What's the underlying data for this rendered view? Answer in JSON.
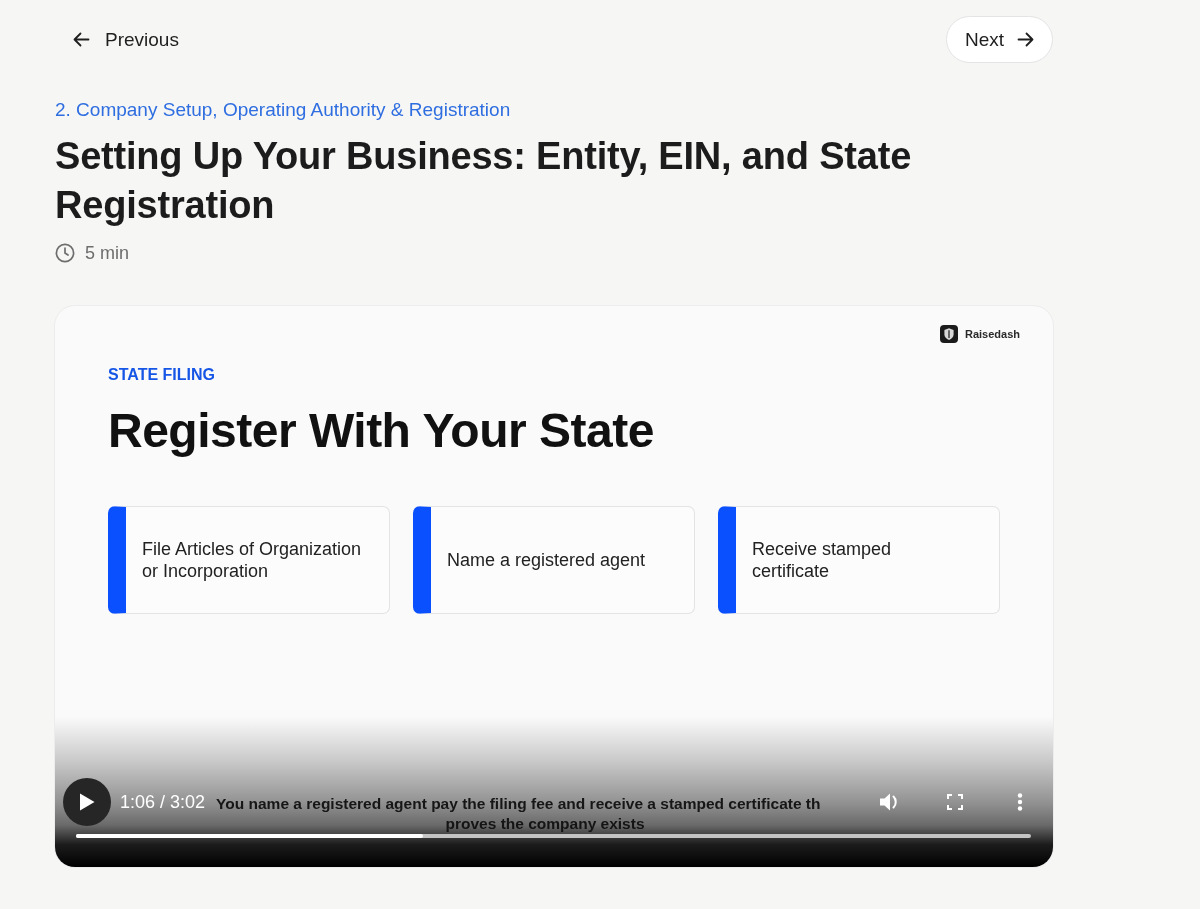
{
  "nav": {
    "previous": {
      "label": "Previous"
    },
    "next": {
      "label": "Next"
    }
  },
  "lesson": {
    "module": "2. Company Setup, Operating Authority & Registration",
    "title": "Setting Up Your Business: Entity, EIN, and State Registration",
    "duration": "5 min"
  },
  "video": {
    "slide": {
      "brand": "Raisedash",
      "eyebrow": "STATE FILING",
      "heading": "Register With Your State",
      "steps": [
        {
          "text": "File Articles of Organization\nor Incorporation"
        },
        {
          "text": "Name a registered agent"
        },
        {
          "text": "Receive stamped\ncertificate"
        }
      ]
    },
    "player": {
      "playing": false,
      "time": "1:06 / 3:02",
      "captions": [
        "You name a registered agent pay the filing fee and receive a stamped certificate th",
        "proves the company exists"
      ],
      "level": 0.363
    }
  }
}
